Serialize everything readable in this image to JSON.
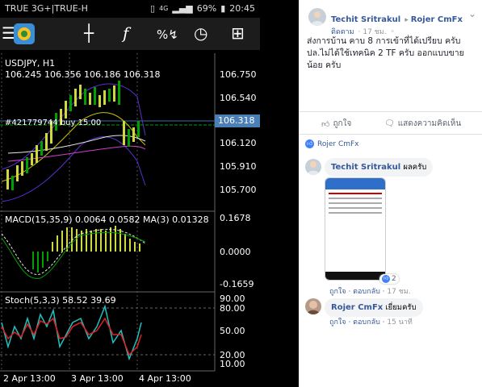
{
  "status_bar": {
    "carrier": "TRUE 3G+|TRUE-H",
    "network": "4G",
    "battery": "69%",
    "time": "20:45"
  },
  "chart": {
    "symbol": "USDJPY, H1",
    "ohlc": "106.245 106.356 106.186 106.318",
    "price_axis": [
      "106.750",
      "106.540",
      "106.318",
      "106.120",
      "105.910",
      "105.700"
    ],
    "current_price": "106.318",
    "order_label": "#421779744 buy 15.00",
    "macd_title": "MACD(15,35,9) 0.0064 0.0582 MA(3) 0.01328",
    "macd_axis": [
      "0.1678",
      "0.0000",
      "-0.1659"
    ],
    "stoch_title": "Stoch(5,3,3) 58.52 39.69",
    "stoch_axis": [
      "90.00",
      "80.00",
      "50.00",
      "20.00",
      "10.00"
    ],
    "dates": [
      "2 Apr 13:00",
      "3 Apr 13:00",
      "4 Apr 13:00"
    ]
  },
  "post": {
    "author": "Techit Sritrakul",
    "target": "Rojer CmFx",
    "follow_label": "ติดตาม",
    "time": "17 ชม.",
    "text": "ส่งการบ้าน คาบ 8 การเข้าที่ได้เปรียบ ครับ ปล.ไม่ได้ใช้เทคนิค 2 TF ครับ ออกแบบขายน้อย ครับ",
    "like_label": "ถูกใจ",
    "comment_label": "แสดงความคิดเห็น",
    "reaction_name": "Rojer CmFx"
  },
  "comments": [
    {
      "author": "Techit Sritrakul",
      "text": "ผลครับ",
      "like": "ถูกใจ",
      "reply": "ตอบกลับ",
      "time": "17 ชม.",
      "reactions": "2"
    },
    {
      "author": "Rojer CmFx",
      "text": "เยี่ยมครับ",
      "like": "ถูกใจ",
      "reply": "ตอบกลับ",
      "time": "15 นาที"
    }
  ],
  "colors": {
    "toolbar_bg": "#1c1c1c",
    "price_tag": "#4b7fb5",
    "fb_blue": "#365899",
    "bull": "#cfd93c",
    "bear": "#00a000"
  }
}
